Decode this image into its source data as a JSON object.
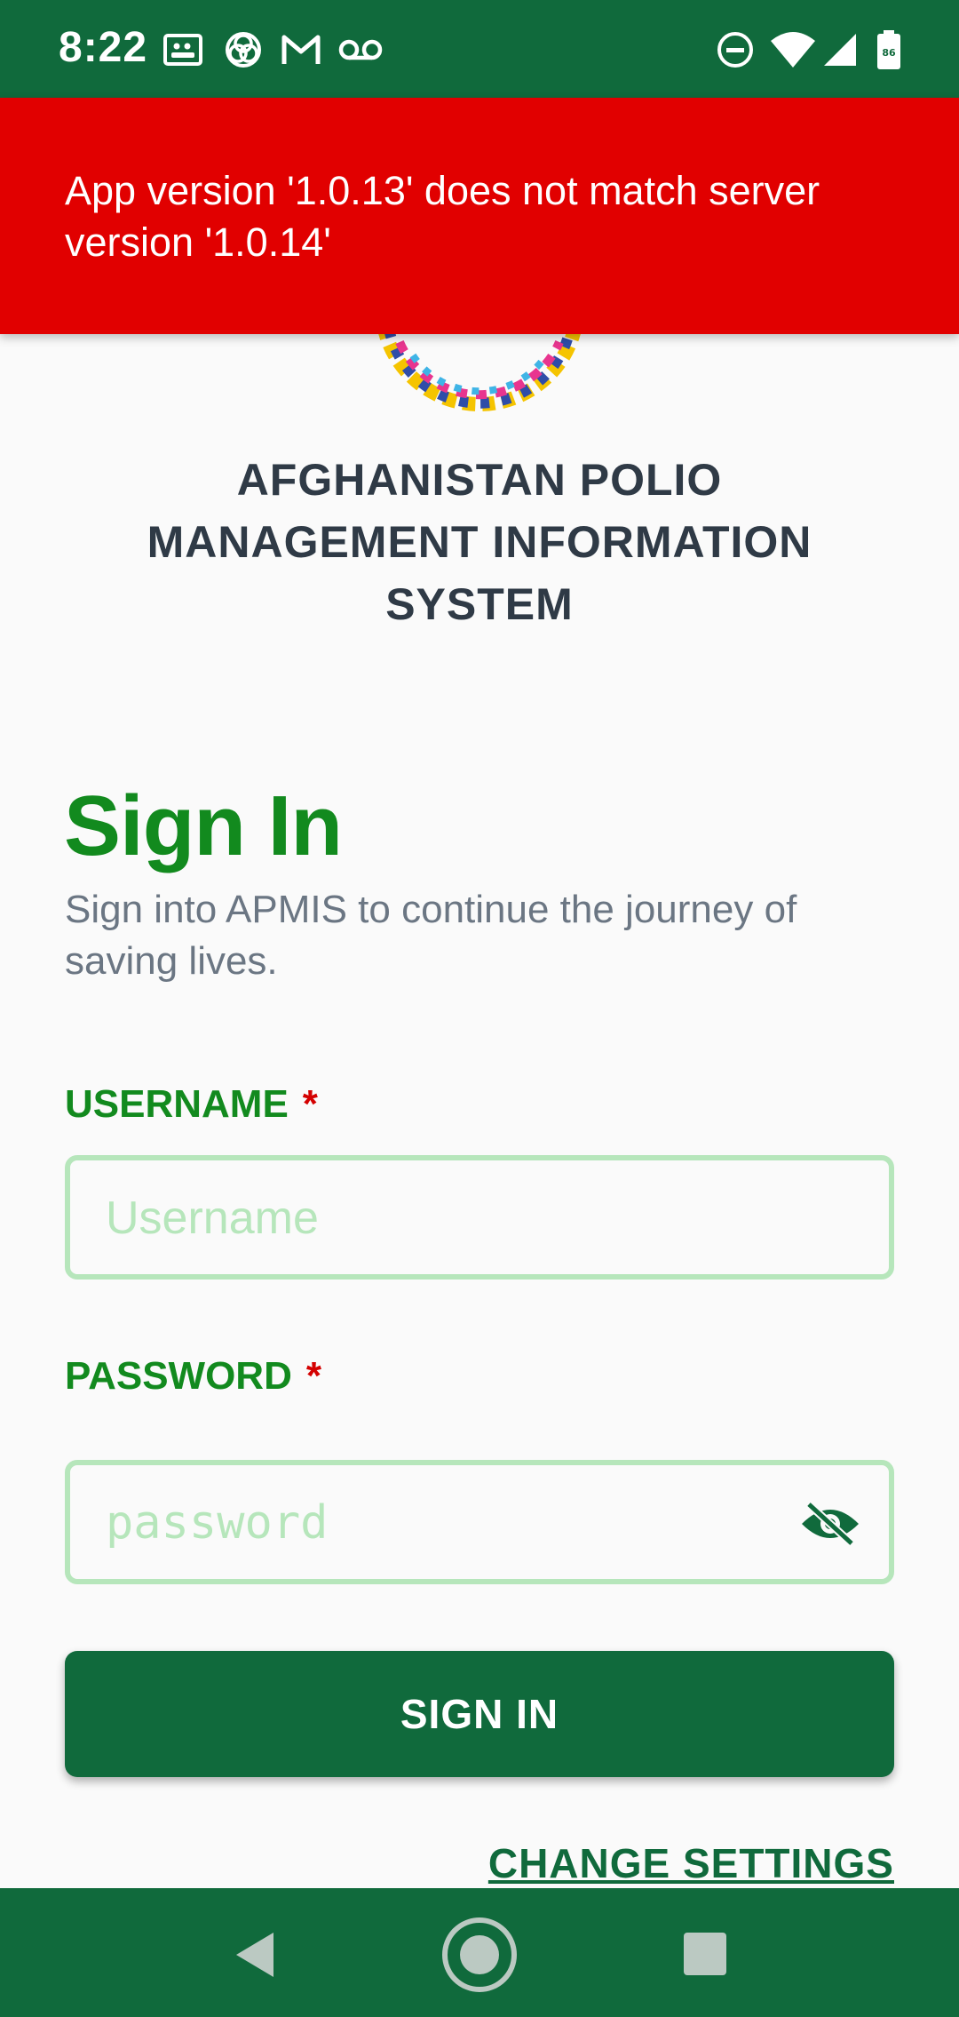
{
  "status_bar": {
    "time": "8:22",
    "battery_level": "86",
    "icons": [
      "image-icon",
      "camera-aperture-icon",
      "gmail-icon",
      "voicemail-icon",
      "do-not-disturb-icon",
      "wifi-icon",
      "cell-signal-icon",
      "battery-icon"
    ]
  },
  "error_banner": {
    "message": "App version '1.0.13' does not match server version '1.0.14'",
    "color": "#e10000"
  },
  "app": {
    "title": "AFGHANISTAN POLIO MANAGEMENT INFORMATION SYSTEM",
    "brand_color": "#106a3c",
    "accent_green": "#128a1e"
  },
  "signin": {
    "heading": "Sign In",
    "subtitle": "Sign into APMIS to continue the journey of saving lives.",
    "username_label": "USERNAME",
    "username_placeholder": "Username",
    "username_value": "",
    "password_label": "PASSWORD",
    "password_placeholder": "password",
    "password_value": "",
    "required_mark": "*",
    "button_label": "SIGN IN",
    "change_settings_label": "CHANGE SETTINGS"
  },
  "nav_bar": {
    "buttons": [
      "back-icon",
      "home-icon",
      "recents-icon"
    ]
  }
}
